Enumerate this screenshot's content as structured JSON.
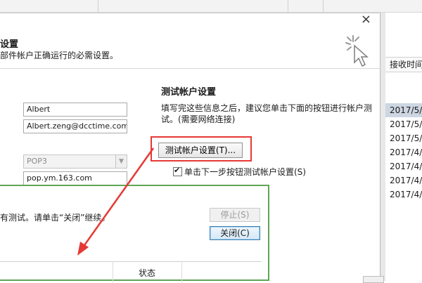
{
  "background_window": {
    "list_header": "接收时间",
    "dates": [
      "2017/5/",
      "2017/5/",
      "2017/5/",
      "2017/4/",
      "2017/4/",
      "2017/4/",
      "2017/4/"
    ]
  },
  "dialog": {
    "close_glyph": "×",
    "title": "设置",
    "subtitle": "部件帐户正确运行的必需设置。",
    "fields": {
      "name": "Albert",
      "email": "Albert.zeng@dcctime.com",
      "account_type": "POP3",
      "incoming_server": "pop.ym.163.com"
    },
    "test_section": {
      "title": "测试帐户设置",
      "description": "填写完这些信息之后，建议您单击下面的按钮进行帐户测试。(需要网络连接)",
      "button_label": "测试帐户设置(T)...",
      "checkbox_label": "单击下一步按钮测试帐户设置(S)",
      "checkbox_checked": true
    }
  },
  "test_dialog": {
    "message": "有测试。请单击“关闭”继续。",
    "stop_label": "停止(S)",
    "close_label": "关闭(C)",
    "grid_header_status": "状态"
  },
  "icons": {
    "cursor_sparkle": "cursor-sparkle-icon",
    "dropdown_arrow": "chevron-down-icon"
  },
  "colors": {
    "highlight": "#e53935",
    "dialog_border": "#5fa557"
  }
}
